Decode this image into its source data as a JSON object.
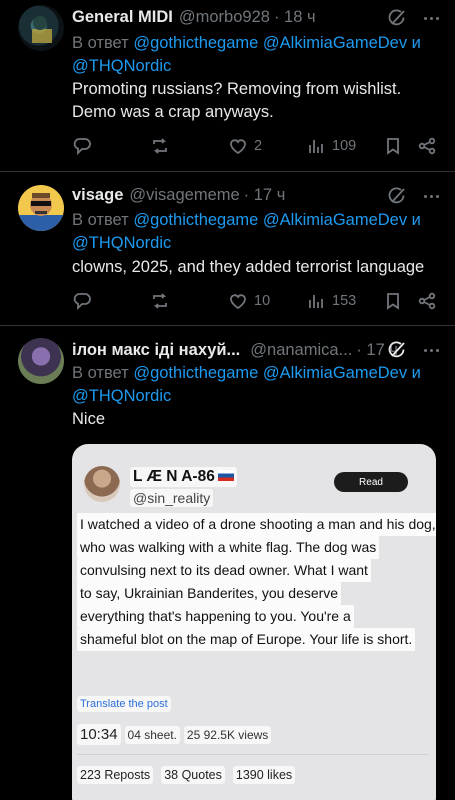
{
  "colors": {
    "background": "#000000",
    "link": "#1d9bf0",
    "muted": "#71767b",
    "text": "#e7e9ea"
  },
  "reply_prefix": "В ответ",
  "tweets": [
    {
      "name": "General MIDI",
      "handle": "@morbo928",
      "time": "· 18 ч",
      "mentions_line1": "@gothicthegame @AlkimiaGameDev и",
      "mentions_line2": "@THQNordic",
      "text_line1": "Promoting russians? Removing from wishlist.",
      "text_line2": "Demo was a crap anyways.",
      "replies": "",
      "reposts": "",
      "likes": "2",
      "views": "109"
    },
    {
      "name": "visage",
      "handle": "@visagememe",
      "time": "· 17 ч",
      "mentions_line1": "@gothicthegame @AlkimiaGameDev и",
      "mentions_line2": "@THQNordic",
      "text_line1": "clowns, 2025, and they added terrorist language",
      "replies": "",
      "reposts": "",
      "likes": "10",
      "views": "153"
    },
    {
      "name": "ілон макс іді нахуй...",
      "handle": "@nanamica...",
      "time": "· 17 ч",
      "mentions_line1": "@gothicthegame @AlkimiaGameDev и",
      "mentions_line2": "@THQNordic",
      "text_line1": "Nice"
    }
  ],
  "screenshot": {
    "name": "L Æ N A-86",
    "handle": "@sin_reality",
    "read_label": "Read",
    "lines": [
      "I watched a video of a drone shooting a man and his dog,",
      "who was walking with a white flag. The dog was",
      "convulsing next to its dead owner. What I want",
      "to say, Ukrainian Banderites, you deserve",
      "everything that's happening to you. You're a",
      "shameful blot on the map of Europe. Your life is short."
    ],
    "translate": "Translate the post",
    "time": "10:34",
    "date": "04 sheet.",
    "views": "25 92.5K views",
    "reposts": "223 Reposts",
    "quotes": "38 Quotes",
    "likes": "1390 likes"
  }
}
